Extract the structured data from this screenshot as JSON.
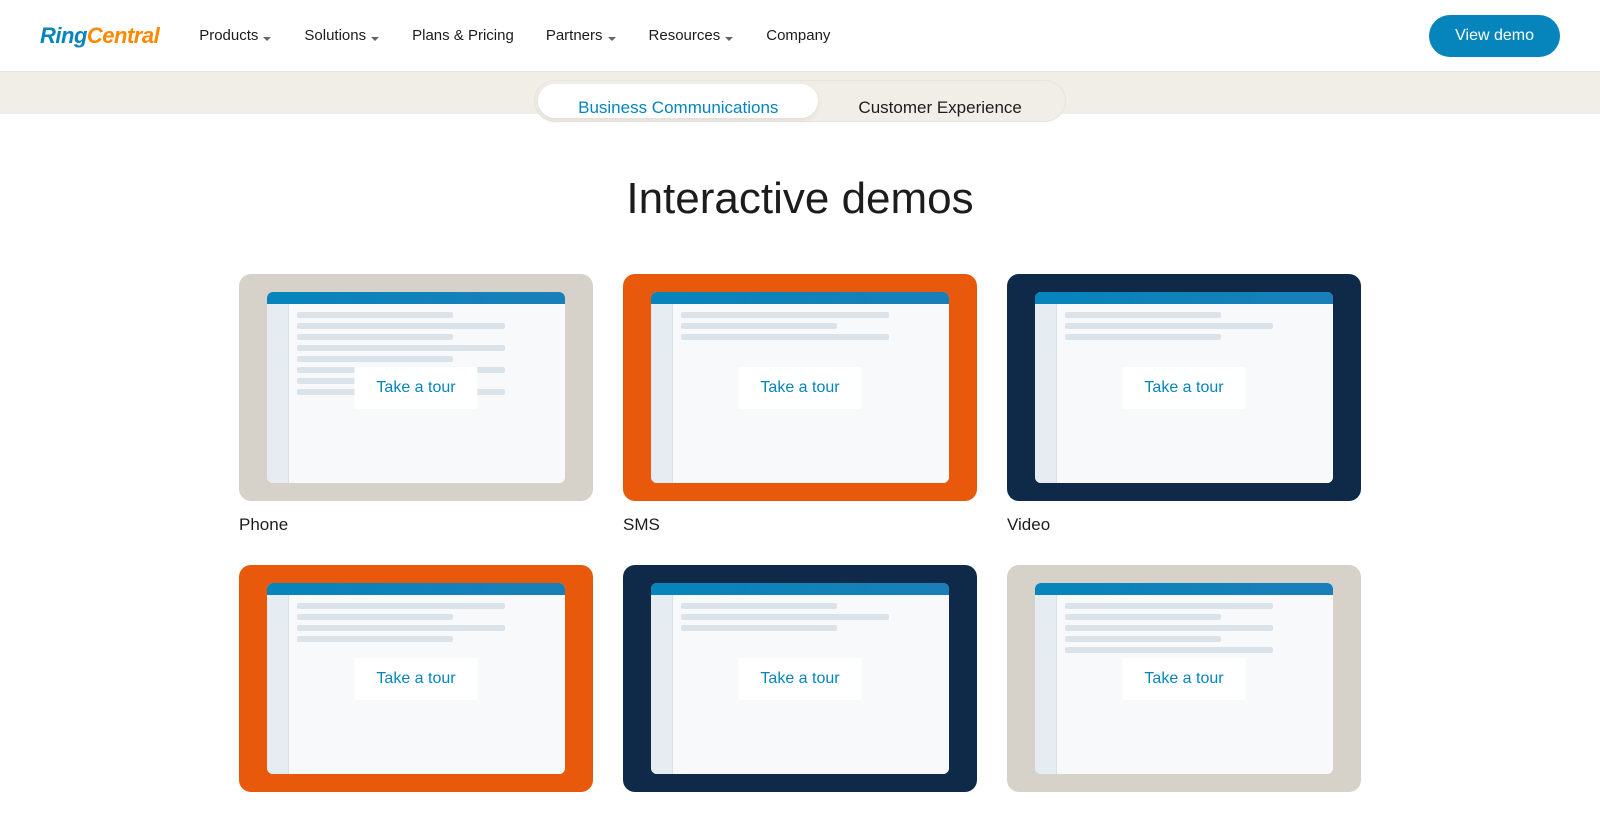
{
  "logo": {
    "part1": "Ring",
    "part2": "Central"
  },
  "nav": {
    "items": [
      {
        "label": "Products",
        "dropdown": true
      },
      {
        "label": "Solutions",
        "dropdown": true
      },
      {
        "label": "Plans & Pricing",
        "dropdown": false
      },
      {
        "label": "Partners",
        "dropdown": true
      },
      {
        "label": "Resources",
        "dropdown": true
      },
      {
        "label": "Company",
        "dropdown": false
      }
    ],
    "cta": "View demo"
  },
  "tabs": {
    "active": "Business Communications",
    "inactive": "Customer Experience"
  },
  "heading": "Interactive demos",
  "tour_label": "Take a tour",
  "cards": [
    {
      "label": "Phone",
      "bg": "grey"
    },
    {
      "label": "SMS",
      "bg": "orange"
    },
    {
      "label": "Video",
      "bg": "navy"
    },
    {
      "label": "",
      "bg": "orange"
    },
    {
      "label": "",
      "bg": "navy"
    },
    {
      "label": "",
      "bg": "grey"
    }
  ]
}
